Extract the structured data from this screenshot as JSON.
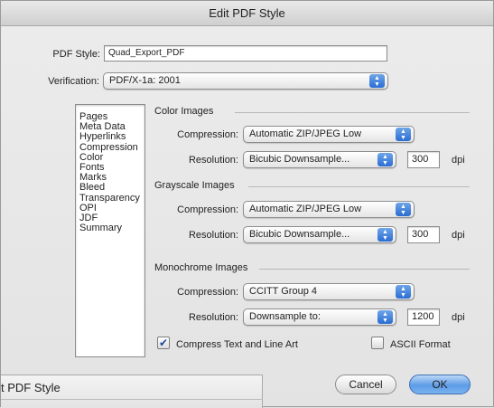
{
  "window": {
    "title": "Edit PDF Style"
  },
  "style": {
    "label": "PDF Style:",
    "value": "Quad_Export_PDF",
    "verification_label": "Verification:",
    "verification_value": "PDF/X-1a: 2001"
  },
  "sidebar": {
    "items": [
      "Pages",
      "Meta Data",
      "Hyperlinks",
      "Compression",
      "Color",
      "Fonts",
      "Marks",
      "Bleed",
      "Transparency",
      "OPI",
      "JDF",
      "Summary"
    ]
  },
  "groups": {
    "color": {
      "title": "Color Images",
      "compression_label": "Compression:",
      "compression_value": "Automatic ZIP/JPEG Low",
      "resolution_label": "Resolution:",
      "resolution_value": "Bicubic Downsample...",
      "dpi_value": "300",
      "dpi_unit": "dpi"
    },
    "grayscale": {
      "title": "Grayscale Images",
      "compression_label": "Compression:",
      "compression_value": "Automatic ZIP/JPEG Low",
      "resolution_label": "Resolution:",
      "resolution_value": "Bicubic Downsample...",
      "dpi_value": "300",
      "dpi_unit": "dpi"
    },
    "mono": {
      "title": "Monochrome Images",
      "compression_label": "Compression:",
      "compression_value": "CCITT Group 4",
      "resolution_label": "Resolution:",
      "resolution_value": "Downsample to:",
      "dpi_value": "1200",
      "dpi_unit": "dpi"
    }
  },
  "options": {
    "compress_text_label": "Compress Text and Line Art",
    "compress_text_checked": true,
    "ascii_label": "ASCII Format",
    "ascii_checked": false
  },
  "buttons": {
    "cancel": "Cancel",
    "ok": "OK"
  },
  "ghost": {
    "title": "t PDF Style"
  },
  "icons": {
    "popup": "popup-stepper-icon",
    "check": "checkmark-icon"
  },
  "colors": {
    "accent": "#2a6cd3",
    "default_button": "#5d9ce6"
  }
}
